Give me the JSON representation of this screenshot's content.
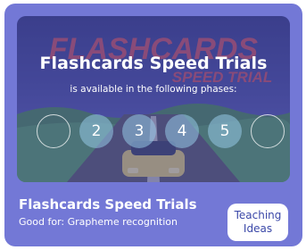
{
  "banner": {
    "background_logo_line1": "FLASHCARDS",
    "background_logo_line2": "SPEED TRIAL",
    "title": "Flashcards Speed Trials",
    "subtitle": "is available in the following phases:",
    "phases": [
      "",
      "2",
      "3",
      "4",
      "5",
      ""
    ]
  },
  "card": {
    "title": "Flashcards Speed Trials",
    "good_for": "Good for: Grapheme recognition"
  },
  "teaching_button": {
    "line1": "Teaching",
    "line2": "Ideas"
  },
  "colors": {
    "card_bg": "#7378d6",
    "button_text": "#3b48a8",
    "phase_active": "#96c8e6"
  }
}
